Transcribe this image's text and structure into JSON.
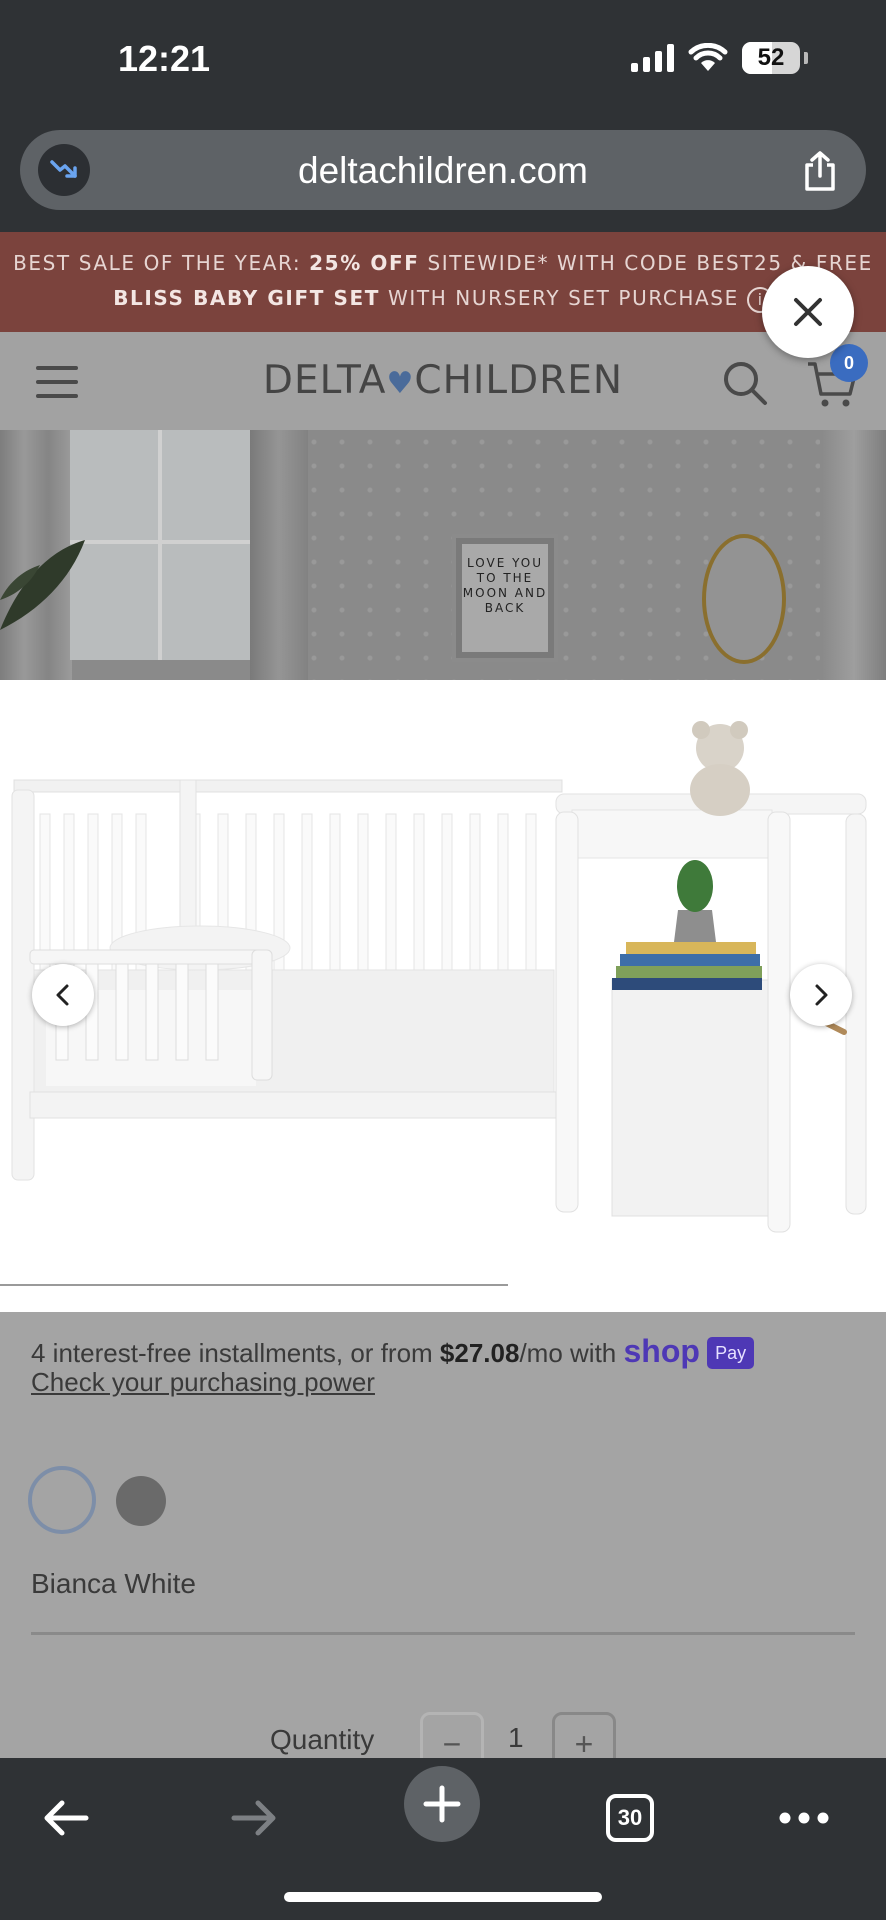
{
  "status_bar": {
    "time": "12:21",
    "battery": "52"
  },
  "browser": {
    "url": "deltachildren.com"
  },
  "promo": {
    "line1_a": "BEST SALE OF THE YEAR: ",
    "line1_b": "25% OFF",
    "line1_c": " SITEWIDE* WITH CODE BEST25 & FREE",
    "line2_a": "BLISS BABY GIFT SET",
    "line2_b": " WITH NURSERY SET PURCHASE",
    "info_glyph": "i"
  },
  "header": {
    "logo_left": "DELTA",
    "logo_heart": "♥",
    "logo_right": "CHILDREN",
    "cart_count": "0"
  },
  "room_art": {
    "frame_text": "LOVE YOU TO THE MOON AND BACK"
  },
  "product": {
    "installments_prefix": "4 interest-free installments, or from ",
    "installments_price": "$27.08",
    "installments_suffix": "/mo with ",
    "shop_logo": "shop",
    "pay_badge": "Pay",
    "check_link": "Check your purchasing power",
    "color_name": "Bianca White",
    "quantity_label": "Quantity",
    "quantity_value": "1",
    "minus": "−",
    "plus": "+"
  },
  "toolbar": {
    "tab_count": "30"
  },
  "colors": {
    "promo_bg": "#7b433d",
    "shop_purple": "#4e38b5",
    "cart_badge": "#3a6cc0",
    "chrome": "#2f3235"
  }
}
